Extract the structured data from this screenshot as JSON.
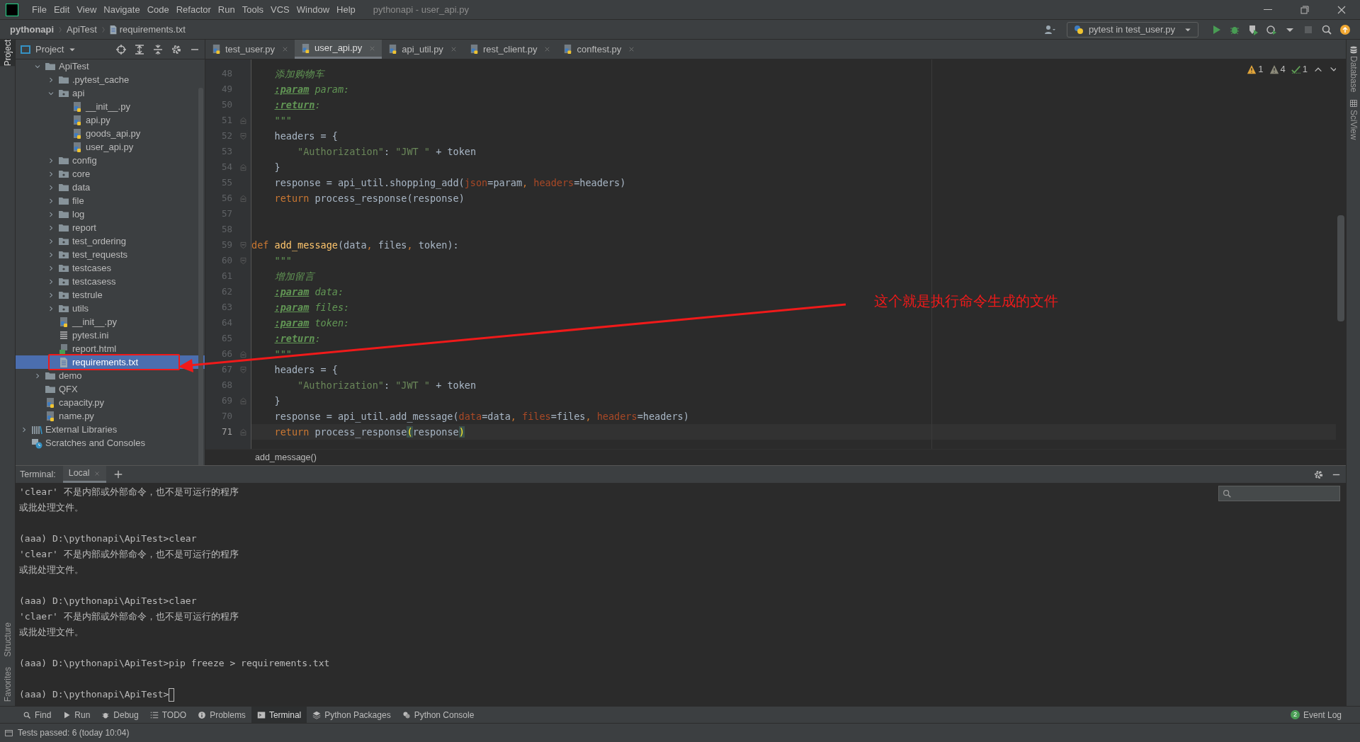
{
  "menu": {
    "items": [
      "File",
      "Edit",
      "View",
      "Navigate",
      "Code",
      "Refactor",
      "Run",
      "Tools",
      "VCS",
      "Window",
      "Help"
    ],
    "title": "pythonapi - user_api.py"
  },
  "navbar": {
    "breadcrumb": [
      "pythonapi",
      "ApiTest",
      "requirements.txt"
    ],
    "run_config": "pytest in test_user.py"
  },
  "project_panel": {
    "title": "Project",
    "tree": [
      {
        "label": "ApiTest",
        "kind": "folder",
        "expanded": true,
        "selected": false,
        "children": [
          {
            "label": ".pytest_cache",
            "kind": "folder",
            "expanded": false,
            "selected": false
          },
          {
            "label": "api",
            "kind": "package",
            "expanded": true,
            "selected": false,
            "children": [
              {
                "label": "__init__.py",
                "kind": "python",
                "selected": false
              },
              {
                "label": "api.py",
                "kind": "python",
                "selected": false
              },
              {
                "label": "goods_api.py",
                "kind": "python",
                "selected": false
              },
              {
                "label": "user_api.py",
                "kind": "python",
                "selected": false
              }
            ]
          },
          {
            "label": "config",
            "kind": "folder",
            "expanded": false,
            "selected": false
          },
          {
            "label": "core",
            "kind": "package",
            "expanded": false,
            "selected": false
          },
          {
            "label": "data",
            "kind": "folder",
            "expanded": false,
            "selected": false
          },
          {
            "label": "file",
            "kind": "folder",
            "expanded": false,
            "selected": false
          },
          {
            "label": "log",
            "kind": "folder",
            "expanded": false,
            "selected": false
          },
          {
            "label": "report",
            "kind": "folder",
            "expanded": false,
            "selected": false
          },
          {
            "label": "test_ordering",
            "kind": "package",
            "expanded": false,
            "selected": false
          },
          {
            "label": "test_requests",
            "kind": "package",
            "expanded": false,
            "selected": false
          },
          {
            "label": "testcases",
            "kind": "package",
            "expanded": false,
            "selected": false
          },
          {
            "label": "testcasess",
            "kind": "package",
            "expanded": false,
            "selected": false
          },
          {
            "label": "testrule",
            "kind": "package",
            "expanded": false,
            "selected": false
          },
          {
            "label": "utils",
            "kind": "package",
            "expanded": false,
            "selected": false
          },
          {
            "label": "__init__.py",
            "kind": "python",
            "selected": false
          },
          {
            "label": "pytest.ini",
            "kind": "ini",
            "selected": false
          },
          {
            "label": "report.html",
            "kind": "html",
            "selected": false
          },
          {
            "label": "requirements.txt",
            "kind": "text",
            "selected": true
          }
        ]
      },
      {
        "label": "demo",
        "kind": "folder",
        "expanded": false,
        "selected": false
      },
      {
        "label": "QFX",
        "kind": "folder",
        "selected": false
      },
      {
        "label": "capacity.py",
        "kind": "python",
        "selected": false
      },
      {
        "label": "name.py",
        "kind": "python",
        "selected": false
      }
    ],
    "roots": [
      {
        "label": "External Libraries",
        "kind": "libraries",
        "expanded": false,
        "selected": false
      },
      {
        "label": "Scratches and Consoles",
        "kind": "scratches",
        "selected": false
      }
    ]
  },
  "editor_tabs": [
    {
      "label": "test_user.py",
      "selected": false
    },
    {
      "label": "user_api.py",
      "selected": true
    },
    {
      "label": "api_util.py",
      "selected": false
    },
    {
      "label": "rest_client.py",
      "selected": false
    },
    {
      "label": "conftest.py",
      "selected": false
    }
  ],
  "inspections": [
    {
      "kind": "warning",
      "count": "1"
    },
    {
      "kind": "weak",
      "count": "4"
    },
    {
      "kind": "typo",
      "count": "1"
    }
  ],
  "code": [
    {
      "n": "48",
      "current": false,
      "kind": "line",
      "tokens": [
        {
          "kind": "doc",
          "text": "    添加购物车"
        }
      ]
    },
    {
      "n": "49",
      "current": false,
      "kind": "line",
      "tokens": [
        {
          "kind": "tag",
          "text": "    :param"
        },
        {
          "kind": "doc",
          "text": " param:"
        }
      ]
    },
    {
      "n": "50",
      "current": false,
      "kind": "line",
      "tokens": [
        {
          "kind": "tag",
          "text": "    :return"
        },
        {
          "kind": "doc",
          "text": ":"
        }
      ]
    },
    {
      "n": "51",
      "current": false,
      "kind": "closer",
      "tokens": [
        {
          "kind": "doc",
          "text": "    \"\"\""
        }
      ]
    },
    {
      "n": "52",
      "current": false,
      "kind": "opener",
      "tokens": [
        {
          "kind": "plain",
          "text": "    headers = {"
        }
      ]
    },
    {
      "n": "53",
      "current": false,
      "kind": "line",
      "tokens": [
        {
          "kind": "str",
          "text": "        \"Authorization\""
        },
        {
          "kind": "plain",
          "text": ": "
        },
        {
          "kind": "str",
          "text": "\"JWT \""
        },
        {
          "kind": "plain",
          "text": " + token"
        }
      ]
    },
    {
      "n": "54",
      "current": false,
      "kind": "closer",
      "tokens": [
        {
          "kind": "plain",
          "text": "    }"
        }
      ]
    },
    {
      "n": "55",
      "current": false,
      "kind": "line",
      "tokens": [
        {
          "kind": "plain",
          "text": "    response = api_util.shopping_add("
        },
        {
          "kind": "arg",
          "text": "json"
        },
        {
          "kind": "plain",
          "text": "=param"
        },
        {
          "kind": "keyword",
          "text": ", "
        },
        {
          "kind": "arg",
          "text": "headers"
        },
        {
          "kind": "plain",
          "text": "=headers)"
        }
      ]
    },
    {
      "n": "56",
      "current": false,
      "kind": "closer",
      "tokens": [
        {
          "kind": "keyword",
          "text": "    return"
        },
        {
          "kind": "plain",
          "text": " process_response(response)"
        }
      ]
    },
    {
      "n": "57",
      "current": false,
      "kind": "line"
    },
    {
      "n": "58",
      "current": false,
      "kind": "line"
    },
    {
      "n": "59",
      "current": false,
      "kind": "opener",
      "tokens": [
        {
          "kind": "keyword",
          "text": "def"
        },
        {
          "kind": "function",
          "text": " add_message"
        },
        {
          "kind": "plain",
          "text": "(data"
        },
        {
          "kind": "keyword",
          "text": ", "
        },
        {
          "kind": "plain",
          "text": "files"
        },
        {
          "kind": "keyword",
          "text": ", "
        },
        {
          "kind": "plain",
          "text": "token):"
        }
      ]
    },
    {
      "n": "60",
      "current": false,
      "kind": "opener",
      "tokens": [
        {
          "kind": "doc",
          "text": "    \"\"\""
        }
      ]
    },
    {
      "n": "61",
      "current": false,
      "kind": "line",
      "tokens": [
        {
          "kind": "doc",
          "text": "    增加留言"
        }
      ]
    },
    {
      "n": "62",
      "current": false,
      "kind": "line",
      "tokens": [
        {
          "kind": "tag",
          "text": "    :param"
        },
        {
          "kind": "doc",
          "text": " data:"
        }
      ]
    },
    {
      "n": "63",
      "current": false,
      "kind": "line",
      "tokens": [
        {
          "kind": "tag",
          "text": "    :param"
        },
        {
          "kind": "doc",
          "text": " files:"
        }
      ]
    },
    {
      "n": "64",
      "current": false,
      "kind": "line",
      "tokens": [
        {
          "kind": "tag",
          "text": "    :param"
        },
        {
          "kind": "doc",
          "text": " token:"
        }
      ]
    },
    {
      "n": "65",
      "current": false,
      "kind": "line",
      "tokens": [
        {
          "kind": "tag",
          "text": "    :return"
        },
        {
          "kind": "doc",
          "text": ":"
        }
      ]
    },
    {
      "n": "66",
      "current": false,
      "kind": "closer",
      "tokens": [
        {
          "kind": "doc",
          "text": "    \"\"\""
        }
      ]
    },
    {
      "n": "67",
      "current": false,
      "kind": "opener",
      "tokens": [
        {
          "kind": "plain",
          "text": "    headers = {"
        }
      ]
    },
    {
      "n": "68",
      "current": false,
      "kind": "line",
      "tokens": [
        {
          "kind": "str",
          "text": "        \"Authorization\""
        },
        {
          "kind": "plain",
          "text": ": "
        },
        {
          "kind": "str",
          "text": "\"JWT \""
        },
        {
          "kind": "plain",
          "text": " + token"
        }
      ]
    },
    {
      "n": "69",
      "current": false,
      "kind": "closer",
      "tokens": [
        {
          "kind": "plain",
          "text": "    }"
        }
      ]
    },
    {
      "n": "70",
      "current": false,
      "kind": "line",
      "tokens": [
        {
          "kind": "plain",
          "text": "    response = api_util.add_message("
        },
        {
          "kind": "arg",
          "text": "data"
        },
        {
          "kind": "plain",
          "text": "=data"
        },
        {
          "kind": "keyword",
          "text": ", "
        },
        {
          "kind": "arg",
          "text": "files"
        },
        {
          "kind": "plain",
          "text": "=files"
        },
        {
          "kind": "keyword",
          "text": ", "
        },
        {
          "kind": "arg",
          "text": "headers"
        },
        {
          "kind": "plain",
          "text": "=headers)"
        }
      ]
    },
    {
      "n": "71",
      "current": true,
      "kind": "closer",
      "tokens": [
        {
          "kind": "keyword",
          "text": "    return"
        },
        {
          "kind": "plain",
          "text": " process_response"
        },
        {
          "kind": "match",
          "text": "("
        },
        {
          "kind": "plain",
          "text": "response"
        },
        {
          "kind": "match",
          "text": ")"
        }
      ]
    }
  ],
  "editor_breadcrumb": "add_message()",
  "terminal": {
    "label": "Terminal:",
    "tabs": [
      {
        "label": "Local",
        "selected": true
      }
    ],
    "blocks": [
      [
        "'clear' 不是内部或外部命令，也不是可运行的程序",
        "或批处理文件。"
      ],
      [
        "(aaa) D:\\pythonapi\\ApiTest>clear",
        "'clear' 不是内部或外部命令，也不是可运行的程序",
        "或批处理文件。"
      ],
      [
        "(aaa) D:\\pythonapi\\ApiTest>claer",
        "'claer' 不是内部或外部命令，也不是可运行的程序",
        "或批处理文件。"
      ],
      [
        "(aaa) D:\\pythonapi\\ApiTest>pip freeze > requirements.txt"
      ],
      [
        "(aaa) D:\\pythonapi\\ApiTest>"
      ]
    ]
  },
  "left_strip": [
    {
      "label": "Project",
      "selected": true
    },
    {
      "label": "Structure",
      "selected": false
    },
    {
      "label": "Favorites",
      "selected": false
    }
  ],
  "right_strip": [
    "Database",
    "SciView"
  ],
  "tool_tabs": [
    {
      "label": "Find",
      "kind": "search",
      "selected": false
    },
    {
      "label": "Run",
      "kind": "run",
      "selected": false
    },
    {
      "label": "Debug",
      "kind": "debug",
      "selected": false
    },
    {
      "label": "TODO",
      "kind": "list",
      "selected": false
    },
    {
      "label": "Problems",
      "kind": "info",
      "selected": false
    },
    {
      "label": "Terminal",
      "kind": "terminal",
      "selected": true
    },
    {
      "label": "Python Packages",
      "kind": "layers",
      "selected": false
    },
    {
      "label": "Python Console",
      "kind": "python",
      "selected": false
    }
  ],
  "event_log": {
    "label": "Event Log",
    "badge": "2"
  },
  "status": "Tests passed: 6 (today 10:04)",
  "annotation": {
    "text": "这个就是执行命令生成的文件"
  }
}
